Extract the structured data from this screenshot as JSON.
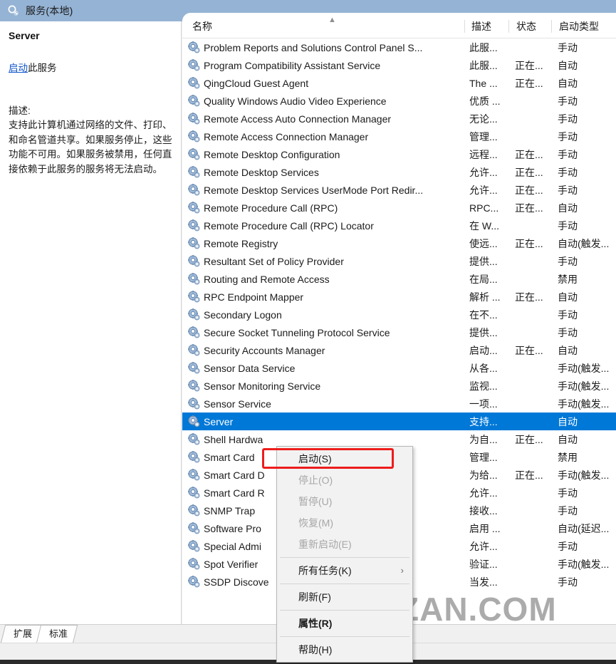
{
  "window": {
    "title": "服务(本地)",
    "icon": "services-magnifier-icon"
  },
  "details_pane": {
    "service_name": "Server",
    "action_link": "启动",
    "action_suffix": "此服务",
    "description_label": "描述:",
    "description_text": "支持此计算机通过网络的文件、打印、和命名管道共享。如果服务停止，这些功能不可用。如果服务被禁用，任何直接依赖于此服务的服务将无法启动。"
  },
  "list": {
    "columns": [
      "名称",
      "描述",
      "状态",
      "启动类型"
    ],
    "sort_column": "名称",
    "sort_direction": "ascending",
    "rows": [
      {
        "name": "Problem Reports and Solutions Control Panel S...",
        "desc": "此服...",
        "status": "",
        "startup": "手动",
        "selected": false
      },
      {
        "name": "Program Compatibility Assistant Service",
        "desc": "此服...",
        "status": "正在...",
        "startup": "自动",
        "selected": false
      },
      {
        "name": "QingCloud Guest Agent",
        "desc": "The ...",
        "status": "正在...",
        "startup": "自动",
        "selected": false
      },
      {
        "name": "Quality Windows Audio Video Experience",
        "desc": "优质 ...",
        "status": "",
        "startup": "手动",
        "selected": false
      },
      {
        "name": "Remote Access Auto Connection Manager",
        "desc": "无论...",
        "status": "",
        "startup": "手动",
        "selected": false
      },
      {
        "name": "Remote Access Connection Manager",
        "desc": "管理...",
        "status": "",
        "startup": "手动",
        "selected": false
      },
      {
        "name": "Remote Desktop Configuration",
        "desc": "远程...",
        "status": "正在...",
        "startup": "手动",
        "selected": false
      },
      {
        "name": "Remote Desktop Services",
        "desc": "允许...",
        "status": "正在...",
        "startup": "手动",
        "selected": false
      },
      {
        "name": "Remote Desktop Services UserMode Port Redir...",
        "desc": "允许...",
        "status": "正在...",
        "startup": "手动",
        "selected": false
      },
      {
        "name": "Remote Procedure Call (RPC)",
        "desc": "RPC...",
        "status": "正在...",
        "startup": "自动",
        "selected": false
      },
      {
        "name": "Remote Procedure Call (RPC) Locator",
        "desc": "在 W...",
        "status": "",
        "startup": "手动",
        "selected": false
      },
      {
        "name": "Remote Registry",
        "desc": "使远...",
        "status": "正在...",
        "startup": "自动(触发...",
        "selected": false
      },
      {
        "name": "Resultant Set of Policy Provider",
        "desc": "提供...",
        "status": "",
        "startup": "手动",
        "selected": false
      },
      {
        "name": "Routing and Remote Access",
        "desc": "在局...",
        "status": "",
        "startup": "禁用",
        "selected": false
      },
      {
        "name": "RPC Endpoint Mapper",
        "desc": "解析 ...",
        "status": "正在...",
        "startup": "自动",
        "selected": false
      },
      {
        "name": "Secondary Logon",
        "desc": "在不...",
        "status": "",
        "startup": "手动",
        "selected": false
      },
      {
        "name": "Secure Socket Tunneling Protocol Service",
        "desc": "提供...",
        "status": "",
        "startup": "手动",
        "selected": false
      },
      {
        "name": "Security Accounts Manager",
        "desc": "启动...",
        "status": "正在...",
        "startup": "自动",
        "selected": false
      },
      {
        "name": "Sensor Data Service",
        "desc": "从各...",
        "status": "",
        "startup": "手动(触发...",
        "selected": false
      },
      {
        "name": "Sensor Monitoring Service",
        "desc": "监视...",
        "status": "",
        "startup": "手动(触发...",
        "selected": false
      },
      {
        "name": "Sensor Service",
        "desc": "一项...",
        "status": "",
        "startup": "手动(触发...",
        "selected": false
      },
      {
        "name": "Server",
        "desc": "支持...",
        "status": "",
        "startup": "自动",
        "selected": true
      },
      {
        "name": "Shell Hardwa",
        "desc": "为自...",
        "status": "正在...",
        "startup": "自动",
        "selected": false
      },
      {
        "name": "Smart Card",
        "desc": "管理...",
        "status": "",
        "startup": "禁用",
        "selected": false
      },
      {
        "name": "Smart Card D",
        "desc": "为给...",
        "status": "正在...",
        "startup": "手动(触发...",
        "selected": false
      },
      {
        "name": "Smart Card R",
        "desc": "允许...",
        "status": "",
        "startup": "手动",
        "selected": false
      },
      {
        "name": "SNMP Trap",
        "desc": "接收...",
        "status": "",
        "startup": "手动",
        "selected": false
      },
      {
        "name": "Software Pro",
        "desc": "启用 ...",
        "status": "",
        "startup": "自动(延迟...",
        "selected": false
      },
      {
        "name": "Special Admi",
        "desc": "允许...",
        "status": "",
        "startup": "手动",
        "selected": false
      },
      {
        "name": "Spot Verifier",
        "desc": "验证...",
        "status": "",
        "startup": "手动(触发...",
        "selected": false
      },
      {
        "name": "SSDP Discove",
        "desc": "当发...",
        "status": "",
        "startup": "手动",
        "selected": false
      }
    ]
  },
  "context_menu": {
    "items": [
      {
        "label": "启动(S)",
        "disabled": false,
        "bold": false,
        "submenu": false,
        "highlighted": true
      },
      {
        "label": "停止(O)",
        "disabled": true,
        "bold": false,
        "submenu": false,
        "highlighted": false
      },
      {
        "label": "暂停(U)",
        "disabled": true,
        "bold": false,
        "submenu": false,
        "highlighted": false
      },
      {
        "label": "恢复(M)",
        "disabled": true,
        "bold": false,
        "submenu": false,
        "highlighted": false
      },
      {
        "label": "重新启动(E)",
        "disabled": true,
        "bold": false,
        "submenu": false,
        "highlighted": false
      },
      {
        "separator": true
      },
      {
        "label": "所有任务(K)",
        "disabled": false,
        "bold": false,
        "submenu": true,
        "highlighted": false
      },
      {
        "separator": true
      },
      {
        "label": "刷新(F)",
        "disabled": false,
        "bold": false,
        "submenu": false,
        "highlighted": false
      },
      {
        "separator": true
      },
      {
        "label": "属性(R)",
        "disabled": false,
        "bold": true,
        "submenu": false,
        "highlighted": false
      },
      {
        "separator": true
      },
      {
        "label": "帮助(H)",
        "disabled": false,
        "bold": false,
        "submenu": false,
        "highlighted": false
      }
    ]
  },
  "tabs": [
    {
      "label": "扩展",
      "active": false
    },
    {
      "label": "标准",
      "active": true
    }
  ],
  "watermark": {
    "text": "ZAN.COM",
    "logo": "hexagon-seven-logo"
  },
  "colors": {
    "header_bar": "#95b3d4",
    "selection": "#0078d7",
    "link": "#1155cc",
    "highlight_box": "#ee1c1c"
  }
}
